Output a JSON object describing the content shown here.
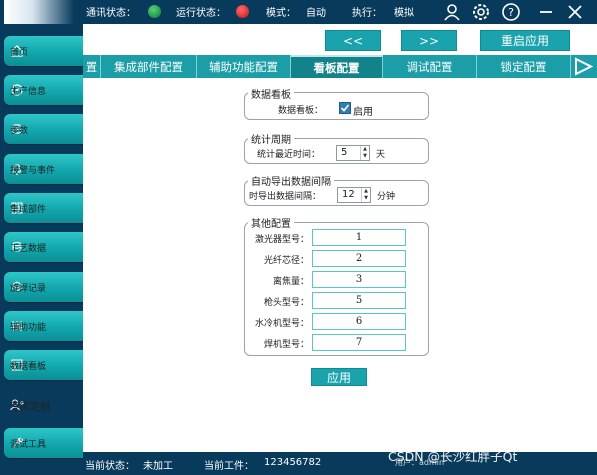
{
  "topbar": {
    "comm_status_label": "通讯状态：",
    "run_status_label": "运行状态：",
    "mode_label": "模式：",
    "mode_value": "自动",
    "exec_label": "执行：",
    "exec_value": "模拟",
    "comm_led_color": "#1a9a4a",
    "run_led_color": "#e02020"
  },
  "sidebar": {
    "items": [
      {
        "label": "首页",
        "icon": "home-icon"
      },
      {
        "label": "生产信息",
        "icon": "compass-icon"
      },
      {
        "label": "参数",
        "icon": "chip-icon"
      },
      {
        "label": "报警与事件",
        "icon": "bell-icon"
      },
      {
        "label": "集成部件",
        "icon": "grid-icon"
      },
      {
        "label": "工艺数据",
        "icon": "database-icon"
      },
      {
        "label": "旋焊记录",
        "icon": "layers-icon"
      },
      {
        "label": "辅助功能",
        "icon": "sliders-icon"
      },
      {
        "label": "数据看板",
        "icon": "dashboard-icon"
      },
      {
        "label": "专家定制",
        "icon": "user-plus-icon"
      },
      {
        "label": "调试工具",
        "icon": "wrench-icon"
      }
    ]
  },
  "commands": {
    "prev": "<<",
    "next": ">>",
    "restart": "重启应用"
  },
  "tabs": [
    {
      "label": "置",
      "active": false
    },
    {
      "label": "集成部件配置",
      "active": false
    },
    {
      "label": "辅助功能配置",
      "active": false
    },
    {
      "label": "看板配置",
      "active": true
    },
    {
      "label": "调试配置",
      "active": false
    },
    {
      "label": "锁定配置",
      "active": false
    }
  ],
  "dashboard_group": {
    "title": "数据看板",
    "label": "数据看板：",
    "checkbox_text": "启用",
    "checked": true
  },
  "stats_group": {
    "title": "统计周期",
    "label": "统计最近时间：",
    "value": "5",
    "unit": "天"
  },
  "export_group": {
    "title": "自动导出数据间隔",
    "label": "时导出数据间隔：",
    "value": "12",
    "unit": "分钟"
  },
  "other_group": {
    "title": "其他配置",
    "fields": [
      {
        "label": "激光器型号：",
        "value": "1"
      },
      {
        "label": "光纤芯径：",
        "value": "2"
      },
      {
        "label": "离焦量：",
        "value": "3"
      },
      {
        "label": "枪头型号：",
        "value": "5"
      },
      {
        "label": "水冷机型号：",
        "value": "6"
      },
      {
        "label": "焊机型号：",
        "value": "7"
      }
    ]
  },
  "apply_label": "应用",
  "bottom": {
    "state_label": "当前状态：",
    "state_value": "未加工",
    "workpiece_label": "当前工件：",
    "workpiece_value": "123456782",
    "user_text": "用户：admin"
  },
  "watermark": "CSDN @长沙红胖子Qt"
}
